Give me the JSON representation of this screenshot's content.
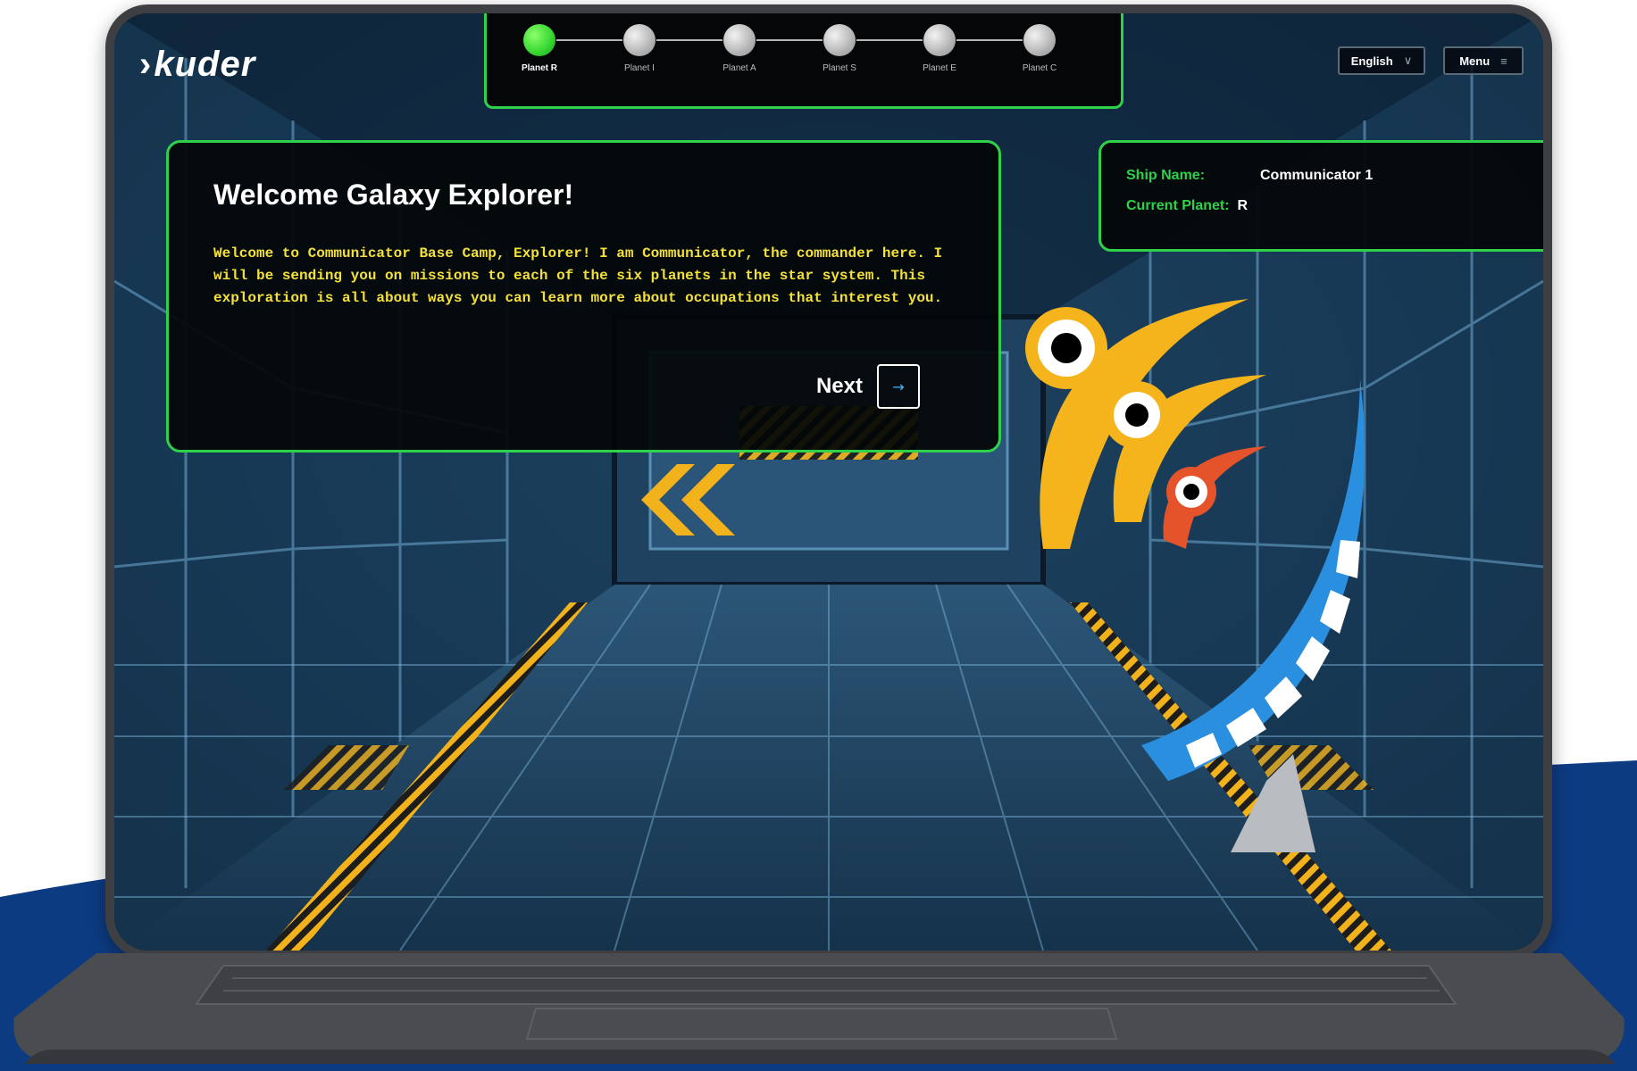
{
  "app": {
    "brand": "kuder"
  },
  "progress": {
    "steps": [
      {
        "label": "Planet R",
        "active": true
      },
      {
        "label": "Planet I",
        "active": false
      },
      {
        "label": "Planet A",
        "active": false
      },
      {
        "label": "Planet S",
        "active": false
      },
      {
        "label": "Planet E",
        "active": false
      },
      {
        "label": "Planet C",
        "active": false
      }
    ]
  },
  "header": {
    "language_label": "English",
    "menu_label": "Menu"
  },
  "dialog": {
    "title": "Welcome Galaxy Explorer!",
    "body": "Welcome to Communicator Base Camp, Explorer! I am Communicator, the commander here. I will be sending you on missions to each of the six planets in the star system. This exploration is all about ways you can learn more about occupations that interest you.",
    "next_label": "Next"
  },
  "ship": {
    "name_label": "Ship Name:",
    "name_value": "Communicator 1",
    "planet_label": "Current Planet:",
    "planet_value": "R"
  },
  "icons": {
    "next_arrow": "arrow-right-icon",
    "language_caret": "chevron-down-icon",
    "menu_icon": "hamburger-icon"
  },
  "colors": {
    "accent": "#2fd14a",
    "body_text": "#f4e03a",
    "brand_blue": "#0d3b82"
  }
}
